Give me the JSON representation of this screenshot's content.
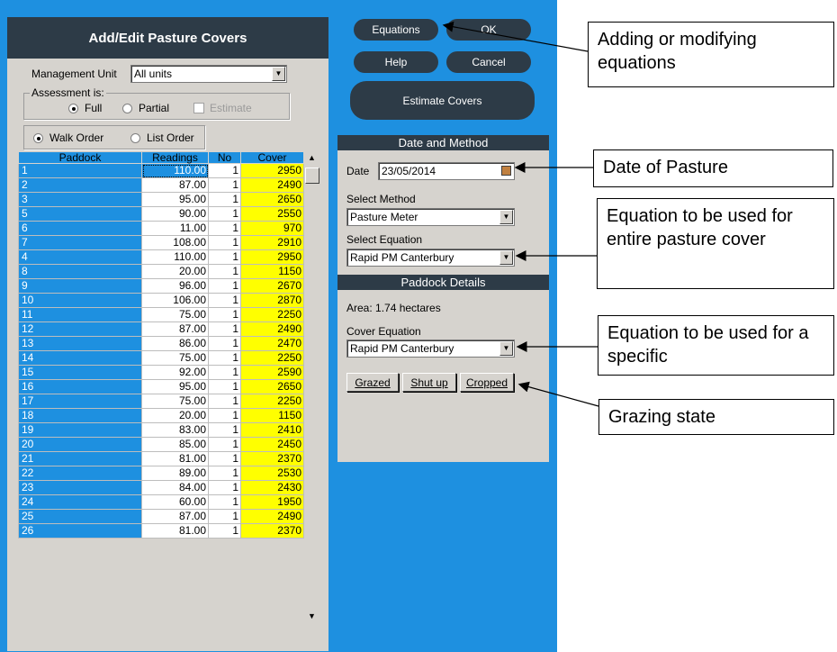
{
  "form": {
    "title": "Add/Edit Pasture Covers",
    "management_unit_label": "Management Unit",
    "management_unit_value": "All units",
    "assessment_label": "Assessment is:",
    "assessment_full": "Full",
    "assessment_partial": "Partial",
    "assessment_estimate": "Estimate",
    "order_walk": "Walk Order",
    "order_list": "List Order"
  },
  "grid": {
    "columns": [
      "Paddock",
      "Readings",
      "No",
      "Cover"
    ],
    "rows": [
      [
        "1",
        "110.00",
        "1",
        "2950"
      ],
      [
        "2",
        "87.00",
        "1",
        "2490"
      ],
      [
        "3",
        "95.00",
        "1",
        "2650"
      ],
      [
        "5",
        "90.00",
        "1",
        "2550"
      ],
      [
        "6",
        "11.00",
        "1",
        "970"
      ],
      [
        "7",
        "108.00",
        "1",
        "2910"
      ],
      [
        "4",
        "110.00",
        "1",
        "2950"
      ],
      [
        "8",
        "20.00",
        "1",
        "1150"
      ],
      [
        "9",
        "96.00",
        "1",
        "2670"
      ],
      [
        "10",
        "106.00",
        "1",
        "2870"
      ],
      [
        "11",
        "75.00",
        "1",
        "2250"
      ],
      [
        "12",
        "87.00",
        "1",
        "2490"
      ],
      [
        "13",
        "86.00",
        "1",
        "2470"
      ],
      [
        "14",
        "75.00",
        "1",
        "2250"
      ],
      [
        "15",
        "92.00",
        "1",
        "2590"
      ],
      [
        "16",
        "95.00",
        "1",
        "2650"
      ],
      [
        "17",
        "75.00",
        "1",
        "2250"
      ],
      [
        "18",
        "20.00",
        "1",
        "1150"
      ],
      [
        "19",
        "83.00",
        "1",
        "2410"
      ],
      [
        "20",
        "85.00",
        "1",
        "2450"
      ],
      [
        "21",
        "81.00",
        "1",
        "2370"
      ],
      [
        "22",
        "89.00",
        "1",
        "2530"
      ],
      [
        "23",
        "84.00",
        "1",
        "2430"
      ],
      [
        "24",
        "60.00",
        "1",
        "1950"
      ],
      [
        "25",
        "87.00",
        "1",
        "2490"
      ],
      [
        "26",
        "81.00",
        "1",
        "2370"
      ]
    ]
  },
  "buttons": {
    "equations": "Equations",
    "ok": "OK",
    "help": "Help",
    "cancel": "Cancel",
    "estimate_covers": "Estimate Covers"
  },
  "date_method": {
    "header": "Date and Method",
    "date_label": "Date",
    "date_value": "23/05/2014",
    "select_method_label": "Select Method",
    "method_value": "Pasture Meter",
    "select_equation_label": "Select Equation",
    "equation_value": "Rapid PM Canterbury"
  },
  "paddock_details": {
    "header": "Paddock Details",
    "area": "Area: 1.74 hectares",
    "cover_equation_label": "Cover Equation",
    "cover_equation_value": "Rapid PM Canterbury",
    "grazed": "Grazed",
    "shut_up": "Shut up",
    "cropped": "Cropped"
  },
  "callouts": {
    "equations": "Adding or modifying equations",
    "date": "Date of Pasture",
    "entire": "Equation to be used for entire pasture cover",
    "specific": "Equation to be used for a specific",
    "grazing": "Grazing state"
  },
  "colors": {
    "app_background": "#1e90e0",
    "dark_header": "#2d3b47",
    "panel": "#d6d3ce",
    "cover_highlight": "#ffff00"
  }
}
